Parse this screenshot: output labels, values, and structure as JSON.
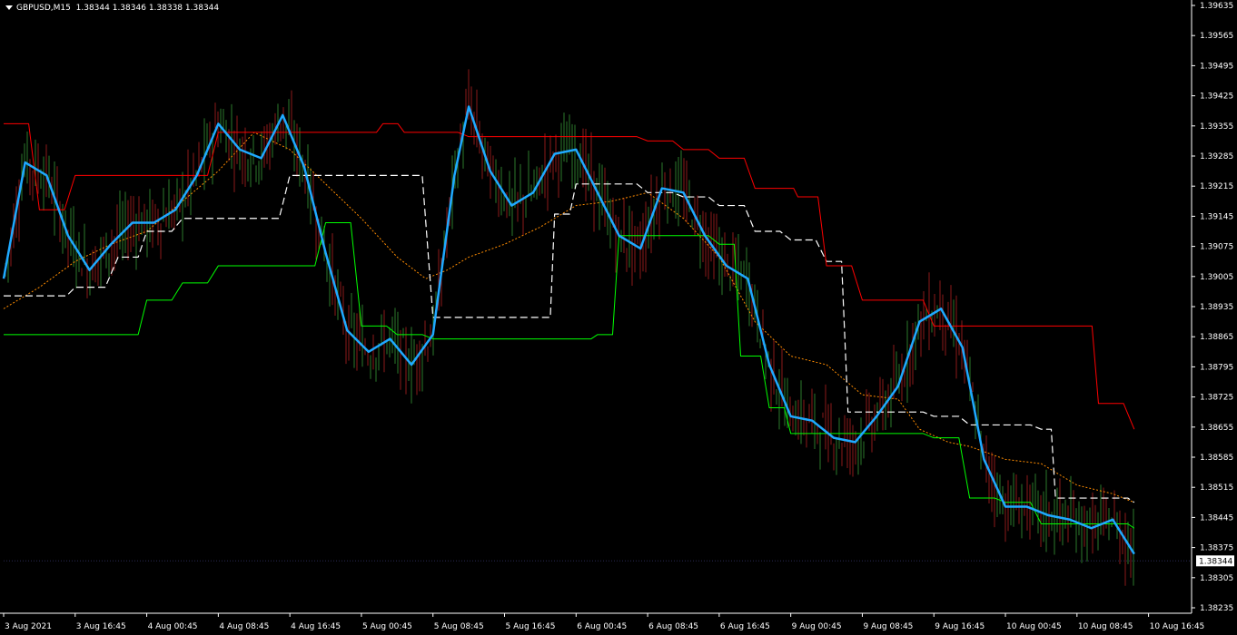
{
  "header": {
    "symbol": "GBPUSD,M15",
    "open": "1.38344",
    "high": "1.38346",
    "low": "1.38338",
    "close": "1.38344"
  },
  "colors": {
    "background": "#000000",
    "axis": "#ffffff",
    "grid": "#1e1e2e",
    "upper_channel": "#ff0000",
    "lower_channel": "#00ff00",
    "white_line": "#ffffff",
    "orange_dotted": "#ff8c00",
    "blue_ma": "#1fa9ff",
    "candle_bull": "#2b7a2b",
    "candle_bear": "#8b1a1a",
    "price_label_bg": "#ffffff",
    "price_label_text": "#000000"
  },
  "chart_data": {
    "type": "line",
    "symbol": "GBPUSD",
    "timeframe": "M15",
    "current_price": "1.38344",
    "y_ticks": [
      "1.39635",
      "1.39565",
      "1.39495",
      "1.39425",
      "1.39355",
      "1.39285",
      "1.39215",
      "1.39145",
      "1.39075",
      "1.39005",
      "1.38935",
      "1.38865",
      "1.38795",
      "1.38725",
      "1.38655",
      "1.38585",
      "1.38515",
      "1.38445",
      "1.38375",
      "1.38305",
      "1.38235"
    ],
    "ylim": [
      1.38235,
      1.39635
    ],
    "x_ticks": [
      "3 Aug 2021",
      "3 Aug 16:45",
      "4 Aug 00:45",
      "4 Aug 08:45",
      "4 Aug 16:45",
      "5 Aug 00:45",
      "5 Aug 08:45",
      "5 Aug 16:45",
      "6 Aug 00:45",
      "6 Aug 08:45",
      "6 Aug 16:45",
      "9 Aug 00:45",
      "9 Aug 08:45",
      "9 Aug 16:45",
      "10 Aug 00:45",
      "10 Aug 08:45",
      "10 Aug 16:45"
    ],
    "grid": false,
    "series": [
      {
        "key": "upper_channel",
        "color": "#ff0000",
        "x": [
          0,
          0.5,
          1,
          1.6,
          2,
          2.5,
          3,
          3.5,
          4,
          4.5,
          5,
          5.3,
          5.6,
          6,
          6.5,
          7,
          7.5,
          8,
          8.5,
          9,
          9.5,
          10,
          10.5,
          10.9,
          11.1,
          11.5,
          12,
          12.5,
          13,
          13.5,
          14,
          14.5,
          15,
          15.3,
          15.8
        ],
        "values": [
          1.3936,
          1.3916,
          1.3924,
          1.3924,
          1.3924,
          1.3924,
          1.3934,
          1.3934,
          1.3934,
          1.3934,
          1.3934,
          1.3936,
          1.3934,
          1.3934,
          1.3933,
          1.3933,
          1.3933,
          1.3933,
          1.3933,
          1.3932,
          1.393,
          1.3928,
          1.3921,
          1.3921,
          1.3919,
          1.3903,
          1.3895,
          1.3895,
          1.3889,
          1.3889,
          1.3889,
          1.3889,
          1.3889,
          1.3871,
          1.3865
        ]
      },
      {
        "key": "lower_channel",
        "color": "#00ff00",
        "x": [
          0,
          0.5,
          1,
          1.6,
          2,
          2.5,
          3,
          3.5,
          4,
          4.5,
          5,
          5.5,
          6,
          6.5,
          7,
          7.5,
          8,
          8.3,
          8.6,
          9,
          9.5,
          10,
          10.3,
          10.7,
          11,
          11.5,
          12,
          12.5,
          13,
          13.5,
          14,
          14.5,
          15,
          15.5,
          15.8
        ],
        "values": [
          1.3887,
          1.3887,
          1.3887,
          1.3887,
          1.3895,
          1.3899,
          1.3903,
          1.3903,
          1.3903,
          1.3913,
          1.3889,
          1.3887,
          1.3886,
          1.3886,
          1.3886,
          1.3886,
          1.3886,
          1.3887,
          1.391,
          1.391,
          1.391,
          1.3908,
          1.3882,
          1.387,
          1.3864,
          1.3864,
          1.3864,
          1.3864,
          1.3863,
          1.3849,
          1.3848,
          1.3843,
          1.3843,
          1.3843,
          1.3842
        ]
      },
      {
        "key": "white_dashed",
        "color": "#ffffff",
        "dash": "8,4",
        "x": [
          0,
          0.6,
          1,
          1.6,
          2,
          2.5,
          3,
          3.5,
          4,
          4.5,
          5,
          5.5,
          6,
          6.5,
          7,
          7.5,
          7.7,
          8,
          8.5,
          9,
          9.5,
          10,
          10.5,
          11,
          11.5,
          11.8,
          12,
          12.5,
          13,
          13.5,
          14,
          14.5,
          14.7,
          15,
          15.5,
          15.8
        ],
        "values": [
          1.3896,
          1.3896,
          1.3898,
          1.3905,
          1.3911,
          1.3914,
          1.3914,
          1.3914,
          1.3924,
          1.3924,
          1.3924,
          1.3924,
          1.3891,
          1.3891,
          1.3891,
          1.3891,
          1.3915,
          1.3922,
          1.3922,
          1.392,
          1.3919,
          1.3917,
          1.3911,
          1.3909,
          1.3904,
          1.3869,
          1.3869,
          1.3869,
          1.3868,
          1.3866,
          1.3866,
          1.3865,
          1.3849,
          1.3849,
          1.3849,
          1.3848
        ]
      },
      {
        "key": "orange_dotted",
        "color": "#ff8c00",
        "dash": "2,2",
        "x": [
          0,
          0.5,
          1,
          1.5,
          2,
          2.5,
          3,
          3.5,
          4,
          4.5,
          5,
          5.5,
          5.9,
          6.2,
          6.5,
          7,
          7.5,
          8,
          8.5,
          9,
          9.5,
          10,
          10.5,
          11,
          11.5,
          12,
          12.5,
          12.8,
          13.2,
          13.5,
          14,
          14.5,
          15,
          15.5,
          15.8
        ],
        "values": [
          1.3893,
          1.3898,
          1.3904,
          1.3908,
          1.3911,
          1.3918,
          1.3925,
          1.3934,
          1.393,
          1.3922,
          1.3914,
          1.3905,
          1.39,
          1.3902,
          1.3905,
          1.3908,
          1.3912,
          1.3917,
          1.3918,
          1.392,
          1.3914,
          1.3905,
          1.389,
          1.3882,
          1.388,
          1.3873,
          1.3872,
          1.3865,
          1.3862,
          1.3861,
          1.3858,
          1.3857,
          1.3852,
          1.385,
          1.3848
        ]
      },
      {
        "key": "blue_ma",
        "color": "#1fa9ff",
        "x": [
          0,
          0.3,
          0.6,
          0.9,
          1.2,
          1.5,
          1.8,
          2.1,
          2.4,
          2.7,
          3.0,
          3.3,
          3.6,
          3.9,
          4.2,
          4.5,
          4.8,
          5.1,
          5.4,
          5.7,
          6.0,
          6.3,
          6.5,
          6.8,
          7.1,
          7.4,
          7.7,
          8.0,
          8.3,
          8.6,
          8.9,
          9.2,
          9.5,
          9.8,
          10.1,
          10.4,
          10.7,
          11.0,
          11.3,
          11.6,
          11.9,
          12.2,
          12.5,
          12.8,
          13.1,
          13.4,
          13.7,
          14.0,
          14.3,
          14.6,
          14.9,
          15.2,
          15.5,
          15.8
        ],
        "values": [
          1.39,
          1.3927,
          1.3924,
          1.391,
          1.3902,
          1.3908,
          1.3913,
          1.3913,
          1.3916,
          1.3924,
          1.3936,
          1.393,
          1.3928,
          1.3938,
          1.3926,
          1.3906,
          1.3888,
          1.3883,
          1.3886,
          1.388,
          1.3887,
          1.3924,
          1.394,
          1.3925,
          1.3917,
          1.392,
          1.3929,
          1.393,
          1.392,
          1.391,
          1.3907,
          1.3921,
          1.392,
          1.391,
          1.3903,
          1.39,
          1.388,
          1.3868,
          1.3867,
          1.3863,
          1.3862,
          1.3868,
          1.3875,
          1.389,
          1.3893,
          1.3884,
          1.3858,
          1.3847,
          1.3847,
          1.3845,
          1.3844,
          1.3842,
          1.3844,
          1.3836
        ]
      }
    ]
  }
}
